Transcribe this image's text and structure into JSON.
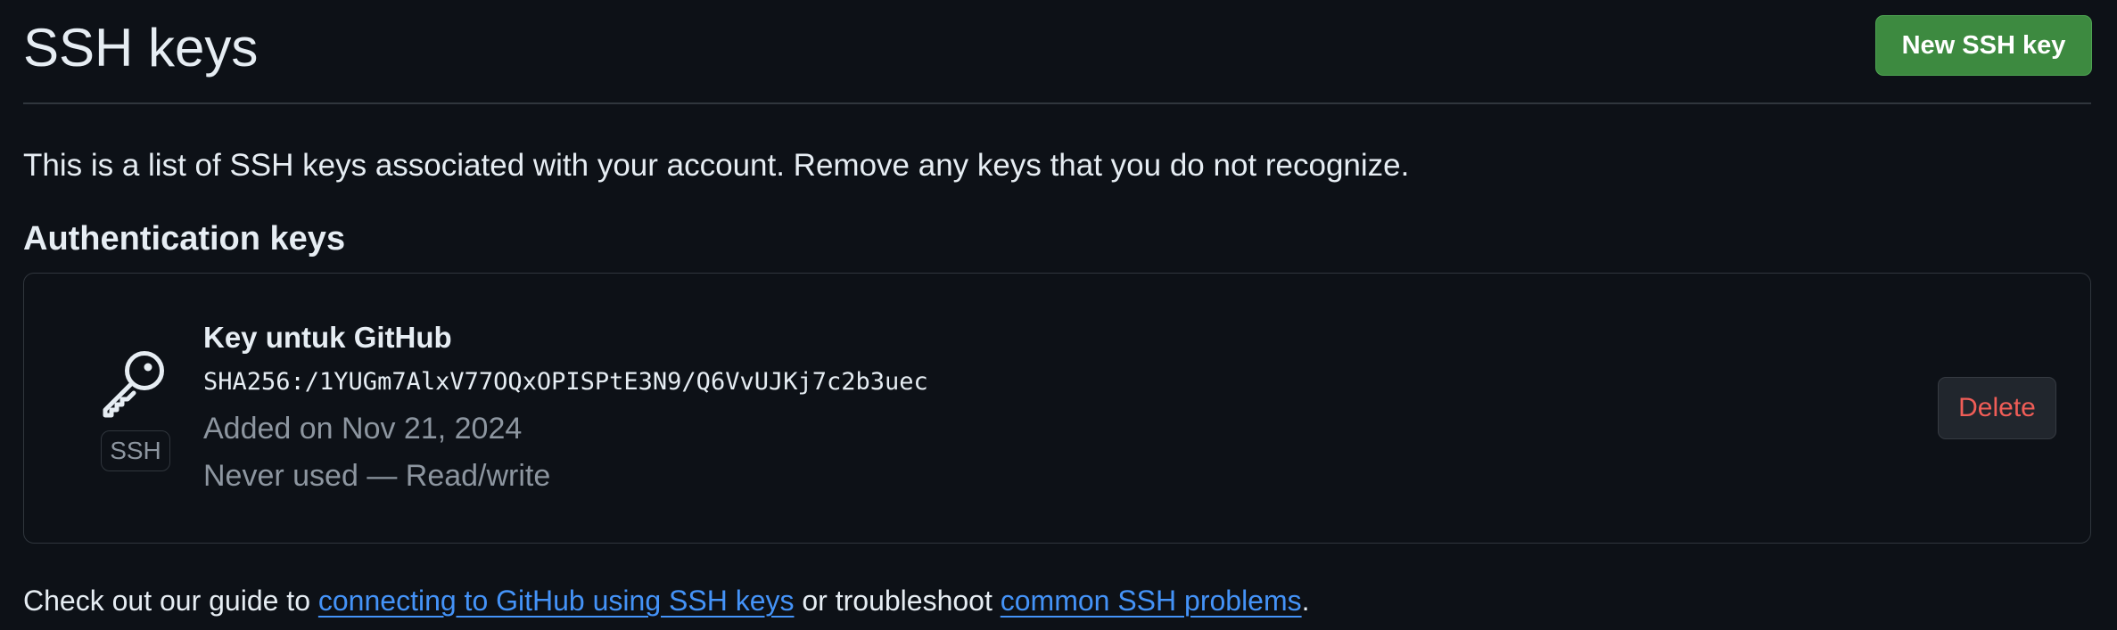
{
  "header": {
    "title": "SSH keys",
    "new_key_label": "New SSH key"
  },
  "intro": {
    "text": "This is a list of SSH keys associated with your account. Remove any keys that you do not recognize."
  },
  "auth_section": {
    "title": "Authentication keys",
    "keys": [
      {
        "icon": "key-icon",
        "type_badge": "SSH",
        "title": "Key untuk GitHub",
        "fingerprint": "SHA256:/1YUGm7AlxV77OQxOPISPtE3N9/Q6VvUJKj7c2b3uec",
        "added": "Added on Nov 21, 2024",
        "usage": "Never used — Read/write",
        "delete_label": "Delete"
      }
    ]
  },
  "footer": {
    "prefix": "Check out our guide to ",
    "link1": "connecting to GitHub using SSH keys",
    "middle": " or troubleshoot ",
    "link2": "common SSH problems",
    "suffix": "."
  },
  "colors": {
    "background": "#0d1117",
    "primary_button": "#3d8a40",
    "danger_text": "#f05d57",
    "link": "#4493f8",
    "muted_text": "#8d96a0",
    "border": "#30363d"
  }
}
